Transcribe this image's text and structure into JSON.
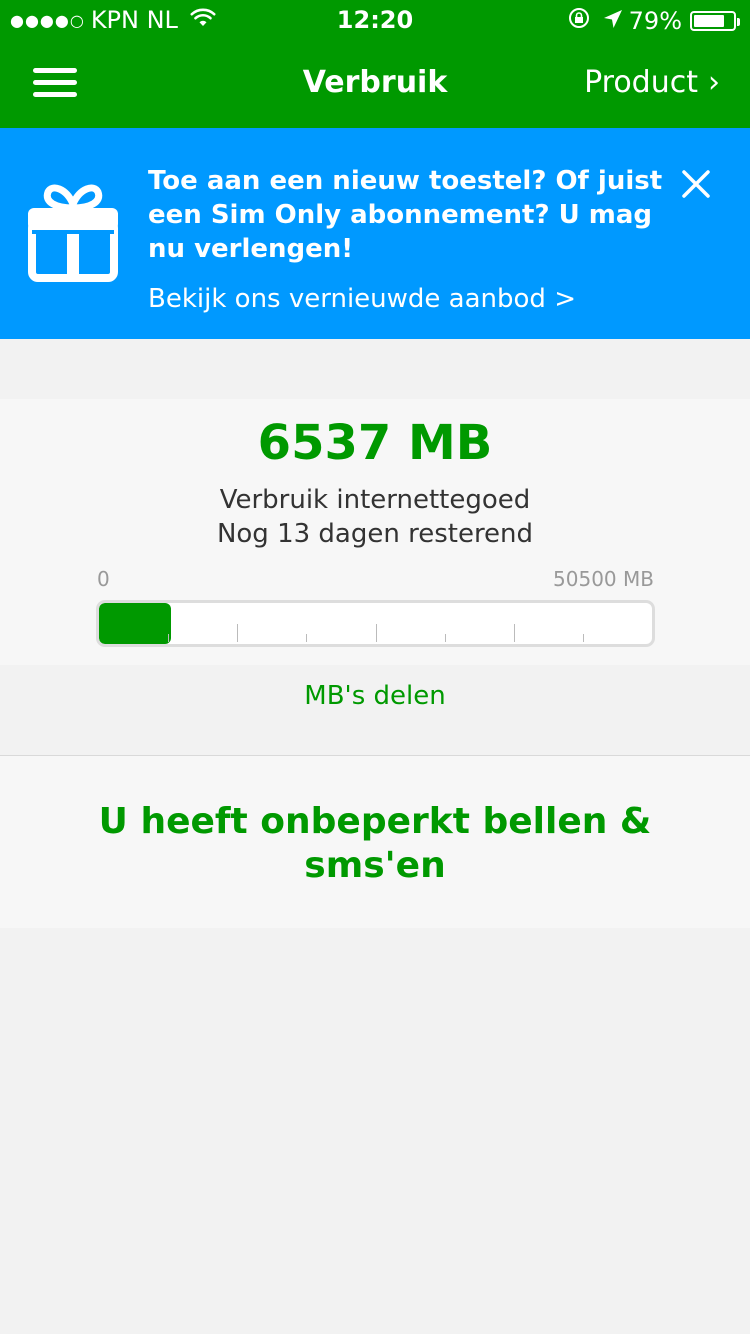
{
  "status_bar": {
    "signal_dots": "●●●●○",
    "carrier": "KPN NL",
    "time": "12:20",
    "battery_percent": "79%",
    "battery_level": 0.79,
    "icons": [
      "wifi-icon",
      "rotation-lock-icon",
      "location-arrow-icon",
      "battery-icon"
    ]
  },
  "nav": {
    "title": "Verbruik",
    "product_label": "Product",
    "product_chevron": "›",
    "menu_icon": "hamburger-menu-icon"
  },
  "promo": {
    "icon": "gift-icon",
    "text": "Toe aan een nieuw toestel? Of juist een Sim Only abonnement? U mag nu verlengen!",
    "link": "Bekijk ons vernieuwde aanbod >",
    "close_icon": "close-icon",
    "background_color": "#0099ff"
  },
  "usage": {
    "amount": "6537 MB",
    "label": "Verbruik internettegoed",
    "remaining": "Nog 13 dagen resterend",
    "scale_min": "0",
    "scale_max": "50500 MB",
    "used_mb": 6537,
    "max_mb": 50500
  },
  "share": {
    "label": "MB's delen"
  },
  "unlimited": {
    "text": "U heeft onbeperkt bellen & sms'en"
  },
  "colors": {
    "brand_green": "#009900",
    "promo_blue": "#0099ff",
    "background": "#f2f2f2"
  }
}
